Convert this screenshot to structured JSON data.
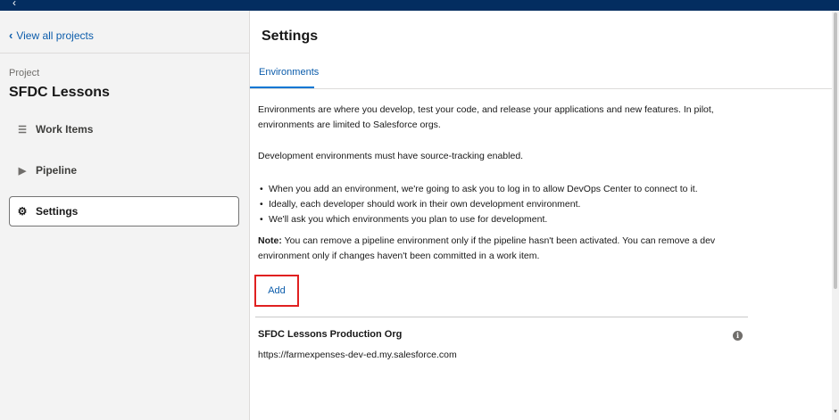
{
  "sidebar": {
    "back_link": "View all projects",
    "project_caption": "Project",
    "project_name": "SFDC Lessons",
    "items": [
      {
        "label": "Work Items",
        "icon": "work-items-icon"
      },
      {
        "label": "Pipeline",
        "icon": "pipeline-icon"
      },
      {
        "label": "Settings",
        "icon": "gear-icon",
        "active": true
      }
    ]
  },
  "main": {
    "title": "Settings",
    "tabs": [
      {
        "label": "Environments",
        "active": true
      }
    ],
    "intro": "Environments are where you develop, test your code, and release your applications and new features. In pilot, environments are limited to Salesforce orgs.",
    "dev_requirement": "Development environments must have source-tracking enabled.",
    "bullets": [
      "When you add an environment, we're going to ask you to log in to allow DevOps Center to connect to it.",
      "Ideally, each developer should work in their own development environment.",
      "We'll ask you which environments you plan to use for development."
    ],
    "note_label": "Note:",
    "note_text": " You can remove a pipeline environment only if the pipeline hasn't been activated. You can remove a dev environment only if changes haven't been committed in a work item.",
    "add_button": "Add",
    "environments": [
      {
        "name": "SFDC Lessons Production Org",
        "url": "https://farmexpenses-dev-ed.my.salesforce.com"
      }
    ]
  },
  "colors": {
    "header": "#032d60",
    "link": "#0b5cab",
    "highlight_box": "#e02020",
    "tab_underline": "#0176d3"
  }
}
